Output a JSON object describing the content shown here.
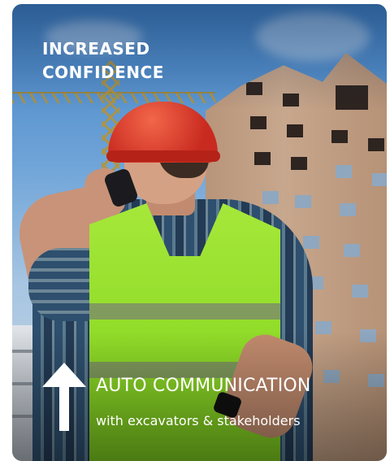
{
  "card": {
    "headline": "INCREASED\nCONFIDENCE",
    "feature": {
      "title": "AUTO COMMUNICATION",
      "subtitle": "with excavators & stakeholders",
      "icon": "arrow-up-icon"
    },
    "photo": {
      "subject": "construction-worker-photo"
    }
  },
  "colors": {
    "text": "#ffffff",
    "vest": "#8fdb28",
    "helmet": "#c92a1f",
    "sky": "#3f7fc3"
  }
}
